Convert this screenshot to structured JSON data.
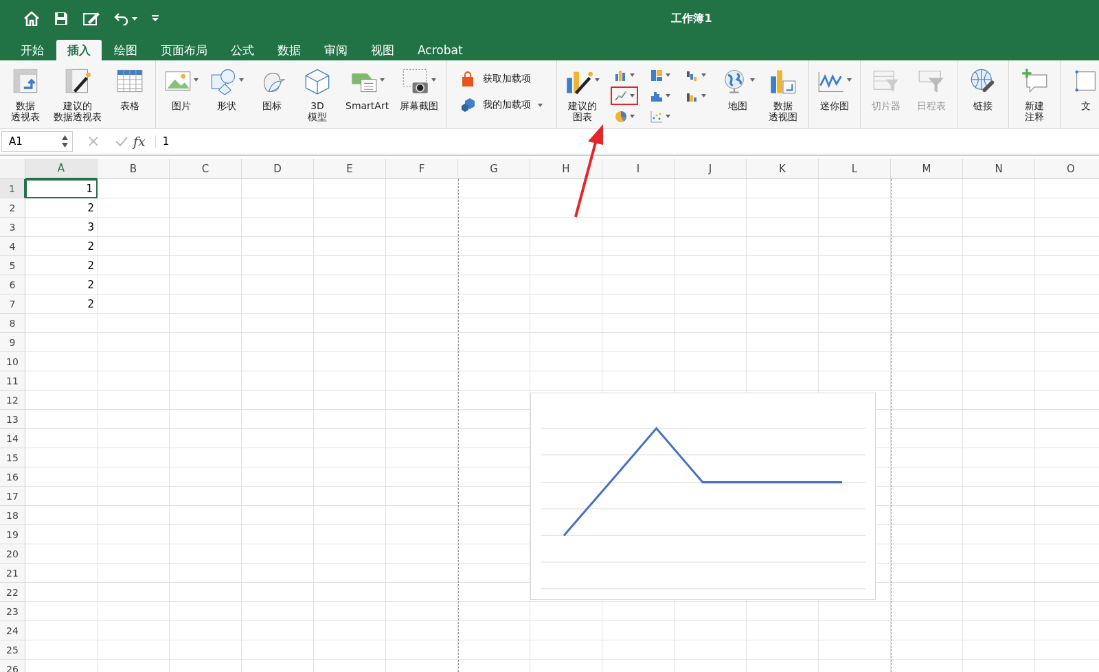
{
  "window": {
    "title": "工作簿1"
  },
  "tabs": [
    {
      "label": "开始",
      "selected": false
    },
    {
      "label": "插入",
      "selected": true
    },
    {
      "label": "绘图",
      "selected": false
    },
    {
      "label": "页面布局",
      "selected": false
    },
    {
      "label": "公式",
      "selected": false
    },
    {
      "label": "数据",
      "selected": false
    },
    {
      "label": "审阅",
      "selected": false
    },
    {
      "label": "视图",
      "selected": false
    },
    {
      "label": "Acrobat",
      "selected": false
    }
  ],
  "ribbon": {
    "groups": [
      {
        "items": [
          {
            "kind": "pivot",
            "label": [
              "数据",
              "透视表"
            ],
            "dropdown": false,
            "disabled": false
          },
          {
            "kind": "suggestpivot",
            "label": [
              "建议的",
              "数据透视表"
            ],
            "dropdown": false,
            "disabled": false
          },
          {
            "kind": "table",
            "label": [
              "表格"
            ],
            "dropdown": false,
            "disabled": false
          }
        ]
      },
      {
        "items": [
          {
            "kind": "pictures",
            "label": [
              "图片"
            ],
            "dropdown": true,
            "disabled": false
          },
          {
            "kind": "shapes",
            "label": [
              "形状"
            ],
            "dropdown": true,
            "disabled": false
          },
          {
            "kind": "icons",
            "label": [
              "图标"
            ],
            "dropdown": false,
            "disabled": false
          },
          {
            "kind": "model",
            "label": [
              "3D",
              "模型"
            ],
            "dropdown": false,
            "disabled": false
          },
          {
            "kind": "smartart",
            "label": [
              "SmartArt"
            ],
            "dropdown": true,
            "disabled": false
          },
          {
            "kind": "screenshot",
            "label": [
              "屏幕截图"
            ],
            "dropdown": true,
            "disabled": false
          }
        ]
      },
      {
        "addins": [
          {
            "kind": "store",
            "label": "获取加载项",
            "dropdown": false
          },
          {
            "kind": "myaddins",
            "label": "我的加载项",
            "dropdown": true
          }
        ]
      },
      {
        "items": [
          {
            "kind": "suggestchart",
            "label": [
              "建议的",
              "图表"
            ],
            "dropdown": true,
            "disabled": false
          }
        ],
        "chart_buttons": [
          [
            {
              "kind": "bar",
              "highlighted": false
            },
            {
              "kind": "line",
              "highlighted": true
            },
            {
              "kind": "pie",
              "highlighted": false
            }
          ],
          [
            {
              "kind": "hierarchy",
              "highlighted": false
            },
            {
              "kind": "statistic",
              "highlighted": false
            },
            {
              "kind": "scatter",
              "highlighted": false
            }
          ],
          [
            {
              "kind": "waterfall",
              "highlighted": false
            },
            {
              "kind": "combo",
              "highlighted": false
            }
          ]
        ],
        "more": [
          {
            "kind": "map",
            "label": [
              "地图"
            ],
            "dropdown": true,
            "disabled": false
          },
          {
            "kind": "pivotchart",
            "label": [
              "数据",
              "透视图"
            ],
            "dropdown": false,
            "disabled": false
          }
        ]
      },
      {
        "items": [
          {
            "kind": "sparkline",
            "label": [
              "迷你图"
            ],
            "dropdown": true,
            "disabled": false
          }
        ]
      },
      {
        "items": [
          {
            "kind": "slicer",
            "label": [
              "切片器"
            ],
            "dropdown": false,
            "disabled": true
          },
          {
            "kind": "timeline",
            "label": [
              "日程表"
            ],
            "dropdown": false,
            "disabled": true
          }
        ]
      },
      {
        "items": [
          {
            "kind": "link",
            "label": [
              "链接"
            ],
            "dropdown": false,
            "disabled": false
          }
        ]
      },
      {
        "items": [
          {
            "kind": "comment",
            "label": [
              "新建",
              "注释"
            ],
            "dropdown": false,
            "disabled": false
          }
        ]
      },
      {
        "items": [
          {
            "kind": "text",
            "label": [
              "文"
            ],
            "dropdown": false,
            "disabled": false
          }
        ]
      }
    ]
  },
  "formula_bar": {
    "name_box": "A1",
    "function_label": "fx",
    "value": "1"
  },
  "sheet": {
    "columns": [
      {
        "label": "A",
        "selected": true
      },
      {
        "label": "B",
        "selected": false
      },
      {
        "label": "C",
        "selected": false
      },
      {
        "label": "D",
        "selected": false
      },
      {
        "label": "E",
        "selected": false
      },
      {
        "label": "F",
        "selected": false
      },
      {
        "label": "G",
        "selected": false
      },
      {
        "label": "H",
        "selected": false
      },
      {
        "label": "I",
        "selected": false
      },
      {
        "label": "J",
        "selected": false
      },
      {
        "label": "K",
        "selected": false
      },
      {
        "label": "L",
        "selected": false
      },
      {
        "label": "M",
        "selected": false
      },
      {
        "label": "N",
        "selected": false
      },
      {
        "label": "O",
        "selected": false
      }
    ],
    "rows": [
      {
        "label": "1",
        "selected": true,
        "cells": [
          "1"
        ]
      },
      {
        "label": "2",
        "selected": false,
        "cells": [
          "2"
        ]
      },
      {
        "label": "3",
        "selected": false,
        "cells": [
          "3"
        ]
      },
      {
        "label": "4",
        "selected": false,
        "cells": [
          "2"
        ]
      },
      {
        "label": "5",
        "selected": false,
        "cells": [
          "2"
        ]
      },
      {
        "label": "6",
        "selected": false,
        "cells": [
          "2"
        ]
      },
      {
        "label": "7",
        "selected": false,
        "cells": [
          "2"
        ]
      },
      {
        "label": "8",
        "selected": false,
        "cells": []
      },
      {
        "label": "9",
        "selected": false,
        "cells": []
      },
      {
        "label": "10",
        "selected": false,
        "cells": []
      },
      {
        "label": "11",
        "selected": false,
        "cells": []
      },
      {
        "label": "12",
        "selected": false,
        "cells": []
      },
      {
        "label": "13",
        "selected": false,
        "cells": []
      },
      {
        "label": "14",
        "selected": false,
        "cells": []
      },
      {
        "label": "15",
        "selected": false,
        "cells": []
      },
      {
        "label": "16",
        "selected": false,
        "cells": []
      },
      {
        "label": "17",
        "selected": false,
        "cells": []
      },
      {
        "label": "18",
        "selected": false,
        "cells": []
      },
      {
        "label": "19",
        "selected": false,
        "cells": []
      },
      {
        "label": "20",
        "selected": false,
        "cells": []
      },
      {
        "label": "21",
        "selected": false,
        "cells": []
      },
      {
        "label": "22",
        "selected": false,
        "cells": []
      },
      {
        "label": "23",
        "selected": false,
        "cells": []
      },
      {
        "label": "24",
        "selected": false,
        "cells": []
      },
      {
        "label": "25",
        "selected": false,
        "cells": []
      },
      {
        "label": "26",
        "selected": false,
        "cells": []
      }
    ]
  },
  "annotation": {
    "arrow": true
  }
}
